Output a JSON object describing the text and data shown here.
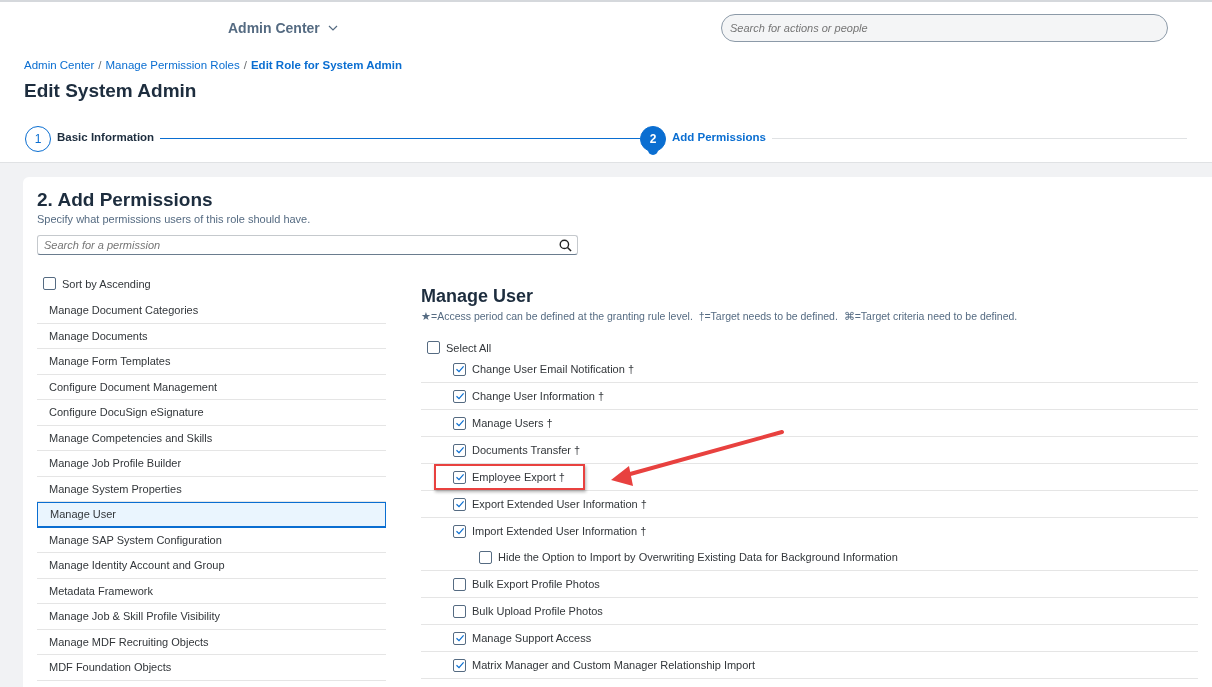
{
  "header": {
    "title": "Admin Center",
    "search": {
      "placeholder": "Search for actions or people"
    }
  },
  "breadcrumb_separator": "/",
  "breadcrumb": [
    {
      "label": "Admin Center",
      "current": false
    },
    {
      "label": "Manage Permission Roles",
      "current": false
    },
    {
      "label": "Edit Role for System Admin",
      "current": true
    }
  ],
  "page_title": "Edit System Admin",
  "steps": [
    {
      "number": "1",
      "label": "Basic Information",
      "selected": false
    },
    {
      "number": "2",
      "label": "Add Permissions",
      "selected": true
    }
  ],
  "section": {
    "title": "2. Add Permissions",
    "subtitle": "Specify what permissions users of this role should have.",
    "search": {
      "placeholder": "Search for a permission"
    }
  },
  "sort": {
    "label": "Sort by Ascending",
    "checked": false
  },
  "categories": [
    {
      "label": "Manage Document Categories",
      "selected": false
    },
    {
      "label": "Manage Documents",
      "selected": false
    },
    {
      "label": "Manage Form Templates",
      "selected": false
    },
    {
      "label": "Configure Document Management",
      "selected": false
    },
    {
      "label": "Configure DocuSign eSignature",
      "selected": false
    },
    {
      "label": "Manage Competencies and Skills",
      "selected": false
    },
    {
      "label": "Manage Job Profile Builder",
      "selected": false
    },
    {
      "label": "Manage System Properties",
      "selected": false
    },
    {
      "label": "Manage User",
      "selected": true
    },
    {
      "label": "Manage SAP System Configuration",
      "selected": false
    },
    {
      "label": "Manage Identity Account and Group",
      "selected": false
    },
    {
      "label": "Metadata Framework",
      "selected": false
    },
    {
      "label": "Manage Job & Skill Profile Visibility",
      "selected": false
    },
    {
      "label": "Manage MDF Recruiting Objects",
      "selected": false
    },
    {
      "label": "MDF Foundation Objects",
      "selected": false
    }
  ],
  "detail": {
    "title": "Manage User",
    "legend": "★=Access period can be defined at the granting rule level.  †=Target needs to be defined.  ⌘=Target criteria need to be defined.",
    "select_all": {
      "label": "Select All",
      "checked": false
    }
  },
  "permissions": [
    {
      "label": "Change User Email Notification †",
      "checked": true,
      "highlighted": false
    },
    {
      "label": "Change User Information †",
      "checked": true,
      "highlighted": false
    },
    {
      "label": "Manage Users †",
      "checked": true,
      "highlighted": false
    },
    {
      "label": "Documents Transfer †",
      "checked": true,
      "highlighted": false
    },
    {
      "label": "Employee Export †",
      "checked": true,
      "highlighted": true
    },
    {
      "label": "Export Extended User Information †",
      "checked": true,
      "highlighted": false
    },
    {
      "label": "Import Extended User Information †",
      "checked": true,
      "highlighted": false,
      "children": [
        {
          "label": "Hide the Option to Import by Overwriting Existing Data for Background Information",
          "checked": false,
          "highlighted": false
        }
      ]
    },
    {
      "label": "Bulk Export Profile Photos",
      "checked": false,
      "highlighted": false
    },
    {
      "label": "Bulk Upload Profile Photos",
      "checked": false,
      "highlighted": false
    },
    {
      "label": "Manage Support Access",
      "checked": true,
      "highlighted": false
    },
    {
      "label": "Matrix Manager and Custom Manager Relationship Import",
      "checked": true,
      "highlighted": false
    }
  ]
}
